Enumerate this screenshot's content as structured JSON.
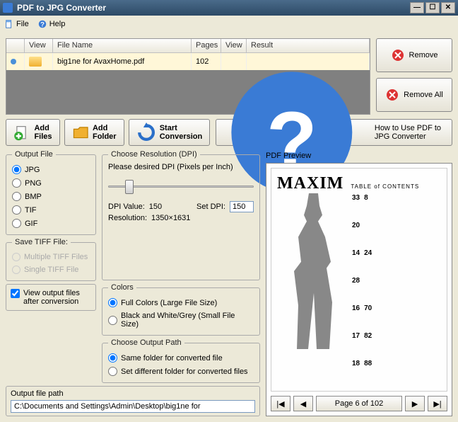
{
  "window": {
    "title": "PDF to JPG Converter"
  },
  "menu": {
    "file": "File",
    "help": "Help"
  },
  "filelist": {
    "headers": {
      "view": "View",
      "filename": "File Name",
      "pages": "Pages",
      "view2": "View",
      "result": "Result"
    },
    "rows": [
      {
        "filename": "big1ne for AvaxHome.pdf",
        "pages": "102"
      }
    ]
  },
  "buttons": {
    "remove": "Remove",
    "removeAll": "Remove All",
    "addFiles": "Add Files",
    "addFolder": "Add Folder",
    "startConv": "Start Conversion",
    "howto": "How to Use PDF to JPG Converter"
  },
  "output": {
    "legend": "Output File",
    "jpg": "JPG",
    "png": "PNG",
    "bmp": "BMP",
    "tif": "TIF",
    "gif": "GIF"
  },
  "dpi": {
    "legend": "Choose Resolution (DPI)",
    "hint": "Please desired DPI (Pixels per Inch)",
    "dpiValueLabel": "DPI Value:",
    "dpiValue": "150",
    "setDpiLabel": "Set DPI:",
    "setDpi": "150",
    "resLabel": "Resolution:",
    "resValue": "1350×1631"
  },
  "saveTiff": {
    "legend": "Save TIFF File:",
    "multiple": "Multiple TIFF Files",
    "single": "Single TIFF File"
  },
  "colors": {
    "legend": "Colors",
    "full": "Full Colors (Large File Size)",
    "bw": "Black and White/Grey (Small File Size)"
  },
  "viewOut": {
    "label": "View output files after conversion"
  },
  "outpath": {
    "legend": "Choose Output Path",
    "same": "Same folder for converted file",
    "diff": "Set different folder for converted files"
  },
  "outFilePath": {
    "legend": "Output file path",
    "value": "C:\\Documents and Settings\\Admin\\Desktop\\big1ne for"
  },
  "preview": {
    "label": "PDF Preview",
    "magazine": "MAXIM",
    "toc": "TABLE of CONTENTS",
    "nums": [
      "33",
      "8",
      "20",
      "14",
      "24",
      "28",
      "16",
      "70",
      "17",
      "82",
      "18",
      "88"
    ],
    "pageInd": "Page 6 of 102"
  }
}
